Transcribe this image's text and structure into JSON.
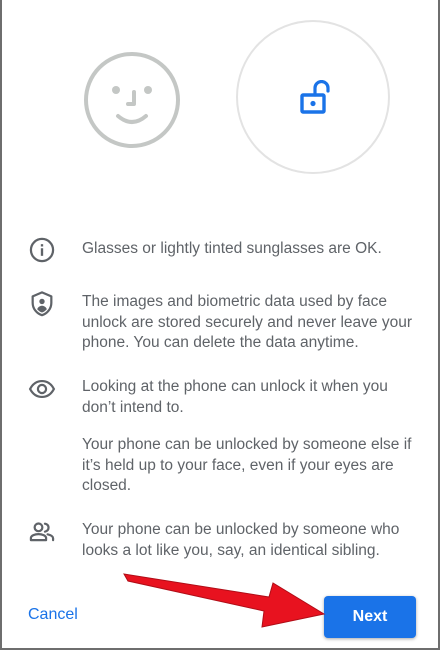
{
  "illustrations": {
    "face_icon": "face-outline-icon",
    "lock_icon": "unlocked-padlock-icon",
    "lock_color": "#1a73e8"
  },
  "info_rows": [
    {
      "icon": "info-icon",
      "paragraphs": [
        "Glasses or lightly tinted sunglasses are OK."
      ]
    },
    {
      "icon": "security-shield-icon",
      "paragraphs": [
        "The images and biometric data used by face unlock are stored securely and never leave your phone. You can delete the data anytime."
      ]
    },
    {
      "icon": "eye-icon",
      "paragraphs": [
        "Looking at the phone can unlock it when you don’t intend to.",
        "Your phone can be unlocked by someone else if it’s held up to your face, even if your eyes are closed."
      ]
    },
    {
      "icon": "people-icon",
      "paragraphs": [
        "Your phone can be unlocked by someone who looks a lot like you, say, an identical sibling."
      ]
    }
  ],
  "footer": {
    "cancel_label": "Cancel",
    "next_label": "Next"
  },
  "colors": {
    "accent": "#1a73e8",
    "text": "#5f6368",
    "annotation_arrow": "#e8121f"
  }
}
